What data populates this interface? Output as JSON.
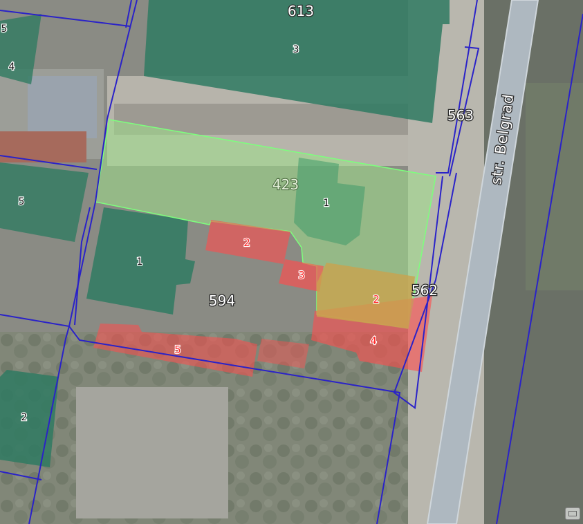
{
  "map": {
    "street_label": "str. Belgrad",
    "parcels": [
      {
        "id": "parcel-613",
        "label": "613"
      },
      {
        "id": "parcel-563",
        "label": "563"
      },
      {
        "id": "parcel-562",
        "label": "562"
      },
      {
        "id": "parcel-594",
        "label": "594"
      },
      {
        "id": "parcel-423",
        "label": "423"
      }
    ],
    "buildings": [
      {
        "id": "building-3-top",
        "label": "3"
      },
      {
        "id": "building-1-green",
        "label": "1"
      },
      {
        "id": "building-1-left",
        "label": "1"
      },
      {
        "id": "building-4-topleft",
        "label": "4"
      },
      {
        "id": "building-5-topleft",
        "label": "5"
      },
      {
        "id": "building-5-left",
        "label": "5"
      },
      {
        "id": "building-2-bottomleft",
        "label": "2"
      }
    ],
    "red_buildings": [
      {
        "id": "red-building-2",
        "label": "2"
      },
      {
        "id": "red-building-3",
        "label": "3"
      },
      {
        "id": "red-building-5",
        "label": "5"
      },
      {
        "id": "red-building-4",
        "label": "4"
      },
      {
        "id": "orange-building-2",
        "label": "2"
      }
    ],
    "colors": {
      "parcel_boundary": "#2a22c8",
      "selected_parcel_fill": "#9ee08a",
      "selected_parcel_stroke": "#7dff7d",
      "existing_building": "#2f7a62",
      "red_building": "#ff4d4d",
      "overlap_building": "#c9a24e",
      "road": "#aeb8c0"
    }
  }
}
